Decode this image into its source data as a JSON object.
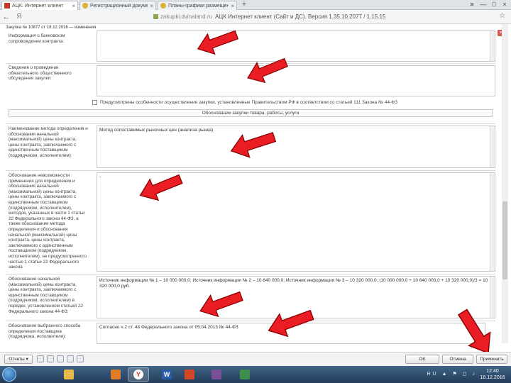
{
  "browser": {
    "tabs": [
      {
        "label": "АЦК: Интернет клиент",
        "close": "×"
      },
      {
        "label": "Регистрационный документ",
        "close": "×"
      },
      {
        "label": "Планы-графики размещения",
        "close": "×"
      }
    ],
    "new_tab": "+",
    "address": {
      "back": "←",
      "brand": "Я",
      "url": "zakupki.dvinaland.ru",
      "page_title": "АЦК Интернет клиент (Сайт и ДС). Версия 1.35.10.2077 / 1.15.15"
    },
    "window_controls": [
      "≡",
      "—",
      "□",
      "×"
    ],
    "bookmark": "☆"
  },
  "form": {
    "purchase_title": "Закупка № 10877 от 18.12.2016 — изменения",
    "close_icon": "×",
    "fields": [
      {
        "label": "Информация о банковском сопровождении контракта:",
        "value": ""
      },
      {
        "label": "Сведения о проведении обязательного общественного обсуждения закупки:",
        "value": ""
      },
      {
        "label": "Наименование метода определения и обоснования начальной (максимальной) цены контракта, цены контракта, заключаемого с единственным поставщиком (подрядчиком, исполнителем):",
        "value": "Метод сопоставимых рыночных цен (анализа рынка)"
      },
      {
        "label": "Обоснование невозможности применения для определения и обоснования начальной (максимальной) цены контракта, цены контракта, заключаемого с единственным поставщиком (подрядчиком, исполнителем), методов, указанных в части 1 статьи 22 Федерального закона 44-ФЗ, а также обоснование метода определения и обоснования начальной (максимальной) цены контракта, цены контракта, заключаемого с единственным поставщиком (подрядчиком, исполнителем), не предусмотренного частью 1 статьи 22 Федерального закона",
        "value": "-"
      },
      {
        "label": "Обоснование начальной (максимальной) цены контракта, цены контракта, заключаемого с единственным поставщиком (подрядчиком, исполнителем) в порядке, установленном статьей 22 Федерального закона 44-ФЗ:",
        "value": "Источник информации № 1 – 10 000 000,0; Источник информации № 2 – 10 640 000,0; Источник информации № 3 – 10 320 000,0; (10 000 000,0 + 10 640 000,0 + 10 320 000,0)/3 = 10 320 000,0 руб."
      },
      {
        "label": "Обоснование выбранного способа определения поставщика (подрядчика, исполнителя):",
        "value": "Согласно ч.2 ст. 48 Федерального закона от 05.04.2013 № 44-ФЗ"
      }
    ],
    "checkbox_label": "Предусмотрены особенности осуществления закупки, установленные Правительством РФ в соответствии со статьей 111 Закона № 44-ФЗ",
    "section_title": "Обоснование закупки товара, работы, услуги",
    "ellipsis": "..."
  },
  "footer": {
    "report_button": "Отчеты ▾",
    "ok_button": "OK",
    "cancel_button": "Отмена",
    "apply_button": "Применить"
  },
  "taskbar": {
    "apps": [
      "folder",
      "media-player",
      "yandex-browser",
      "word",
      "ppt",
      "archive",
      "image-viewer"
    ],
    "tray": "RU ▲ ⚑ ◻ ♪",
    "time": "12:40",
    "date": "18.12.2016"
  },
  "colors": {
    "arrow": "#ea1c24",
    "arrow_outline": "#8b0000",
    "taskbar": "#2b4a6b"
  }
}
